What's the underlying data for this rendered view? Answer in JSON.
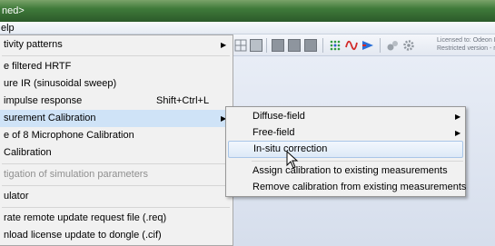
{
  "window": {
    "title": "ned>"
  },
  "menubar": {
    "help_label": "elp"
  },
  "toolbar": {
    "license_line1": "Licensed to: Odeon  L",
    "license_line2": "Restricted version - re",
    "icons": [
      "grid-icon",
      "gray-square-icon",
      "gray-square-icon",
      "gray-square-icon",
      "gray-square-icon",
      "dots-icon",
      "waveform-icon",
      "flag-icon",
      "tools-icon",
      "settings-icon"
    ]
  },
  "main_menu": {
    "items": [
      {
        "label": "tivity patterns",
        "shortcut": "",
        "submenu": true,
        "disabled": false
      },
      {
        "label": "e filtered HRTF",
        "shortcut": "",
        "submenu": false,
        "disabled": false
      },
      {
        "label": "ure IR (sinusoidal sweep)",
        "shortcut": "",
        "submenu": false,
        "disabled": false
      },
      {
        "label": "impulse response",
        "shortcut": "Shift+Ctrl+L",
        "submenu": false,
        "disabled": false
      },
      {
        "label": "surement Calibration",
        "shortcut": "",
        "submenu": true,
        "disabled": false
      },
      {
        "label": "e of 8 Microphone Calibration",
        "shortcut": "",
        "submenu": false,
        "disabled": false
      },
      {
        "label": "Calibration",
        "shortcut": "",
        "submenu": false,
        "disabled": false
      },
      {
        "label": "tigation of simulation parameters",
        "shortcut": "",
        "submenu": false,
        "disabled": true
      },
      {
        "label": "ulator",
        "shortcut": "",
        "submenu": false,
        "disabled": false
      },
      {
        "label": "rate remote update request file  (.req)",
        "shortcut": "",
        "submenu": false,
        "disabled": false
      },
      {
        "label": "nload license update to dongle (.cif)",
        "shortcut": "",
        "submenu": false,
        "disabled": false
      }
    ]
  },
  "sub_menu": {
    "items": [
      {
        "label": "Diffuse-field",
        "submenu": true
      },
      {
        "label": "Free-field",
        "submenu": true
      },
      {
        "label": "In-situ correction",
        "submenu": false
      },
      {
        "label": "Assign calibration to existing measurements",
        "submenu": false
      },
      {
        "label": "Remove calibration from existing measurements",
        "submenu": false
      }
    ]
  },
  "colors": {
    "highlight": "#cfe3f7",
    "titlebar": "#3f7a3a"
  }
}
